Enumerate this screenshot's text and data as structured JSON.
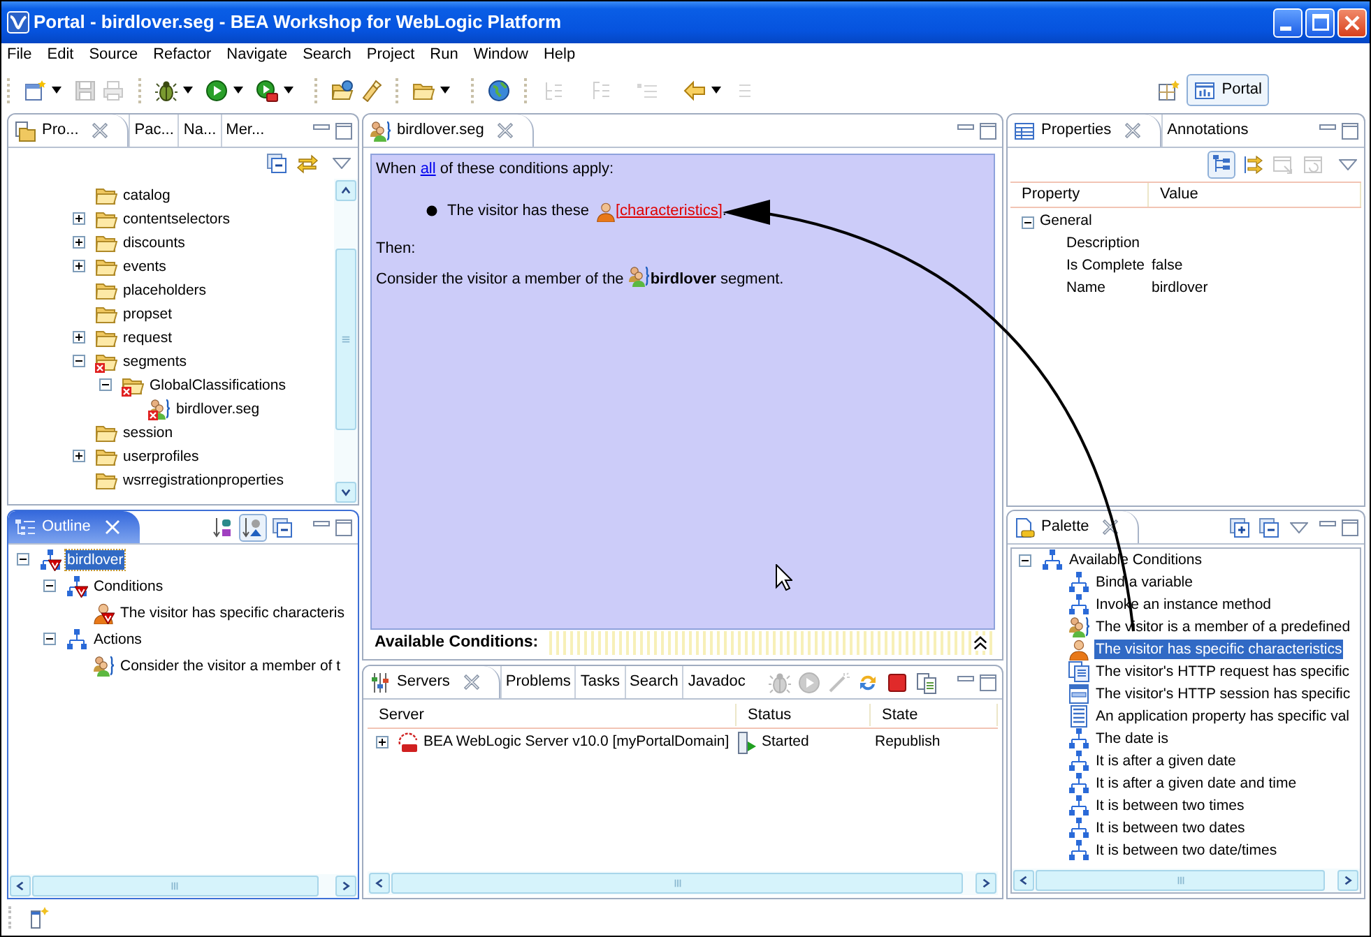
{
  "window": {
    "title": "Portal - birdlover.seg - BEA Workshop for WebLogic Platform"
  },
  "menu": [
    "File",
    "Edit",
    "Source",
    "Refactor",
    "Navigate",
    "Search",
    "Project",
    "Run",
    "Window",
    "Help"
  ],
  "toolbar": [
    {
      "kind": "new",
      "disabled": false,
      "dropdown": true
    },
    {
      "kind": "save",
      "disabled": true,
      "dropdown": false
    },
    {
      "kind": "print",
      "disabled": true,
      "dropdown": false
    },
    {
      "kind": "separator"
    },
    {
      "kind": "debug",
      "disabled": false,
      "dropdown": true
    },
    {
      "kind": "run",
      "disabled": false,
      "dropdown": true
    },
    {
      "kind": "run_tool",
      "disabled": false,
      "dropdown": true
    },
    {
      "kind": "separator"
    },
    {
      "kind": "open_folder",
      "disabled": false,
      "dropdown": false
    },
    {
      "kind": "torch",
      "disabled": false,
      "dropdown": false
    },
    {
      "kind": "separator"
    },
    {
      "kind": "folder",
      "disabled": false,
      "dropdown": true
    },
    {
      "kind": "separator"
    },
    {
      "kind": "globe",
      "disabled": false,
      "dropdown": false
    },
    {
      "kind": "separator"
    },
    {
      "kind": "next_mark",
      "disabled": true,
      "dropdown": false
    },
    {
      "kind": "prev_mark",
      "disabled": true,
      "dropdown": false
    },
    {
      "kind": "last_edit",
      "disabled": true,
      "dropdown": false
    },
    {
      "kind": "back",
      "disabled": false,
      "dropdown": true
    },
    {
      "kind": "forward",
      "disabled": true,
      "dropdown": false
    }
  ],
  "perspective": {
    "label": "Portal",
    "selected": true
  },
  "project_explorer": {
    "active": false,
    "tabs": [
      {
        "label": "Pro...",
        "selected": true
      },
      {
        "label": "Pac...",
        "selected": false
      },
      {
        "label": "Na...",
        "selected": false
      },
      {
        "label": "Mer...",
        "selected": false
      }
    ],
    "toolbar": [
      {
        "kind": "collapse_all"
      },
      {
        "kind": "link_editor"
      }
    ],
    "tree": [
      {
        "label": "catalog",
        "kind": "folder",
        "error": false
      },
      {
        "label": "contentselectors",
        "kind": "folder",
        "error": false,
        "expanded": false
      },
      {
        "label": "discounts",
        "kind": "folder",
        "error": false,
        "expanded": false
      },
      {
        "label": "events",
        "kind": "folder",
        "error": false,
        "expanded": false
      },
      {
        "label": "placeholders",
        "kind": "folder",
        "error": false
      },
      {
        "label": "propset",
        "kind": "folder",
        "error": false
      },
      {
        "label": "request",
        "kind": "folder",
        "error": false,
        "expanded": false
      },
      {
        "label": "segments",
        "kind": "folder",
        "error": true,
        "expanded": true,
        "children": [
          {
            "label": "GlobalClassifications",
            "kind": "folder",
            "error": true,
            "expanded": true,
            "children": [
              {
                "label": "birdlover.seg",
                "kind": "segment",
                "error": true
              }
            ]
          }
        ]
      },
      {
        "label": "session",
        "kind": "folder",
        "error": false
      },
      {
        "label": "userprofiles",
        "kind": "folder",
        "error": false,
        "expanded": false
      },
      {
        "label": "wsrregistrationproperties",
        "kind": "folder",
        "error": false
      }
    ]
  },
  "outline": {
    "active": true,
    "tabs": [
      {
        "label": "Outline",
        "selected": true
      }
    ],
    "toolbar": [
      {
        "kind": "sort",
        "pressed": false
      },
      {
        "kind": "hide",
        "pressed": true
      },
      {
        "kind": "collapse_all",
        "pressed": false
      }
    ],
    "tree": [
      {
        "label": "birdlover",
        "kind": "rule",
        "error": true,
        "selected": true,
        "expanded": true,
        "children": [
          {
            "label": "Conditions",
            "kind": "rule",
            "error": true,
            "selected": false,
            "expanded": true,
            "children": [
              {
                "label": "The visitor has specific characteris",
                "kind": "person",
                "error": true,
                "selected": false
              }
            ]
          },
          {
            "label": "Actions",
            "kind": "rule",
            "error": false,
            "selected": false,
            "expanded": true,
            "children": [
              {
                "label": "Consider the visitor a member of t",
                "kind": "segment",
                "error": false,
                "selected": false
              }
            ]
          }
        ]
      }
    ]
  },
  "editor": {
    "active": false,
    "tabs": [
      {
        "label": "birdlover.seg",
        "selected": true
      }
    ],
    "intro": {
      "before": "When",
      "link": "all",
      "after": "of these conditions apply:"
    },
    "conditions": [
      {
        "before": "The visitor has these",
        "link": "[characteristics]",
        "after": "."
      }
    ],
    "then": "Then:",
    "action": {
      "before": "Consider the visitor a member of the",
      "after": "**birdlover** segment."
    },
    "footer": {
      "label": "Available Conditions:",
      "expanded": false
    }
  },
  "servers": {
    "active": false,
    "tabs": [
      {
        "label": "Servers",
        "selected": true
      },
      {
        "label": "Problems",
        "selected": false
      },
      {
        "label": "Tasks",
        "selected": false
      },
      {
        "label": "Search",
        "selected": false
      },
      {
        "label": "Javadoc",
        "selected": false
      }
    ],
    "toolbar": [
      {
        "kind": "debug",
        "disabled": true
      },
      {
        "kind": "run",
        "disabled": true
      },
      {
        "kind": "profile",
        "disabled": true
      },
      {
        "kind": "publish",
        "disabled": false
      },
      {
        "kind": "stop",
        "disabled": false
      },
      {
        "kind": "disconnect",
        "disabled": false
      }
    ],
    "columns": [
      "Server",
      "Status",
      "State"
    ],
    "rows": [
      {
        "server": "BEA WebLogic Server v10.0 [myPortalDomain]",
        "status": "Started",
        "state": "Republish",
        "expanded": false
      }
    ]
  },
  "properties": {
    "active": false,
    "tabs": [
      {
        "label": "Properties",
        "selected": true
      },
      {
        "label": "Annotations",
        "selected": false
      }
    ],
    "toolbar": [
      {
        "kind": "categories",
        "pressed": true,
        "disabled": false
      },
      {
        "kind": "advanced",
        "pressed": false,
        "disabled": false
      },
      {
        "kind": "restore",
        "pressed": false,
        "disabled": true
      },
      {
        "kind": "defaults",
        "pressed": false,
        "disabled": true
      }
    ],
    "columns": [
      "Property",
      "Value"
    ],
    "groups": [
      {
        "label": "General",
        "expanded": true,
        "rows": [
          {
            "property": "Description"
          },
          {
            "property": "Is Complete",
            "value": "false"
          },
          {
            "property": "Name",
            "value": "birdlover"
          }
        ]
      }
    ]
  },
  "palette": {
    "active": false,
    "tabs": [
      {
        "label": "Palette",
        "selected": true
      }
    ],
    "toolbar": [
      {
        "kind": "expand_all"
      },
      {
        "kind": "collapse_all"
      }
    ],
    "tree": [
      {
        "label": "Available Conditions",
        "kind": "rule",
        "selected": false,
        "expanded": true,
        "children": [
          {
            "label": "Bind a variable",
            "kind": "rule",
            "selected": false
          },
          {
            "label": "Invoke an instance method",
            "kind": "rule",
            "selected": false
          },
          {
            "label": "The visitor is a member of a predefined",
            "kind": "segment",
            "selected": false
          },
          {
            "label": "The visitor has specific characteristics",
            "kind": "person",
            "selected": true
          },
          {
            "label": "The visitor's HTTP request has specific",
            "kind": "request",
            "selected": false
          },
          {
            "label": "The visitor's HTTP session has specific",
            "kind": "session",
            "selected": false
          },
          {
            "label": "An application property has specific val",
            "kind": "property",
            "selected": false
          },
          {
            "label": "The date is",
            "kind": "rule",
            "selected": false
          },
          {
            "label": "It is after a given date",
            "kind": "rule",
            "selected": false
          },
          {
            "label": "It is after a given date and time",
            "kind": "rule",
            "selected": false
          },
          {
            "label": "It is between two times",
            "kind": "rule",
            "selected": false
          },
          {
            "label": "It is between two dates",
            "kind": "rule",
            "selected": false
          },
          {
            "label": "It is between two date/times",
            "kind": "rule",
            "selected": false
          }
        ]
      }
    ]
  }
}
